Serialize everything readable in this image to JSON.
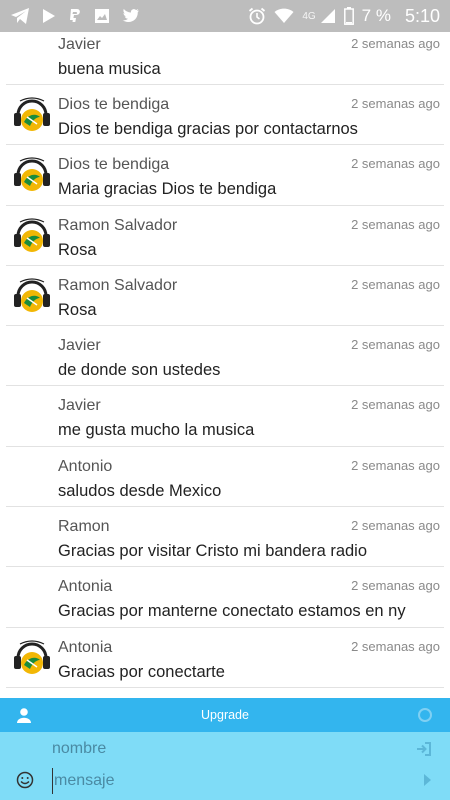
{
  "status_bar": {
    "network": "4G",
    "battery": "7 %",
    "time": "5:10",
    "left_icons": [
      "telegram-icon",
      "play-icon",
      "paypal-icon",
      "image-icon",
      "twitter-icon"
    ],
    "right_icons": [
      "alarm-icon",
      "wifi-icon",
      "signal-icon",
      "battery-icon"
    ]
  },
  "messages": [
    {
      "name": "Javier",
      "time": "2 semanas ago",
      "text": "buena musica",
      "avatar": false
    },
    {
      "name": "Dios te bendiga",
      "time": "2 semanas ago",
      "text": "Dios te bendiga gracias por contactarnos",
      "avatar": true
    },
    {
      "name": "Dios te bendiga",
      "time": "2 semanas ago",
      "text": "Maria gracias Dios te bendiga",
      "avatar": true
    },
    {
      "name": "Ramon Salvador",
      "time": "2 semanas ago",
      "text": "Rosa",
      "avatar": true
    },
    {
      "name": "Ramon Salvador",
      "time": "2 semanas ago",
      "text": "Rosa",
      "avatar": true
    },
    {
      "name": "Javier",
      "time": "2 semanas ago",
      "text": "de donde son ustedes",
      "avatar": false
    },
    {
      "name": "Javier",
      "time": "2 semanas ago",
      "text": "me gusta mucho la musica",
      "avatar": false
    },
    {
      "name": "Antonio",
      "time": "2 semanas ago",
      "text": "saludos desde Mexico",
      "avatar": false
    },
    {
      "name": "Ramon",
      "time": "2 semanas ago",
      "text": "Gracias por visitar Cristo mi bandera radio",
      "avatar": false
    },
    {
      "name": "Antonia",
      "time": "2 semanas ago",
      "text": "Gracias por manterne conectato estamos en ny",
      "avatar": false
    },
    {
      "name": "Antonia",
      "time": "2 semanas ago",
      "text": "Gracias por conectarte",
      "avatar": true
    }
  ],
  "toolbar": {
    "upgrade_label": "Upgrade"
  },
  "compose": {
    "name_placeholder": "nombre",
    "name_value": "",
    "message_placeholder": "mensaje",
    "message_value": ""
  },
  "colors": {
    "toolbar": "#33b5ee",
    "compose": "#7fdcf7",
    "status_bar": "#bdbdbd"
  }
}
